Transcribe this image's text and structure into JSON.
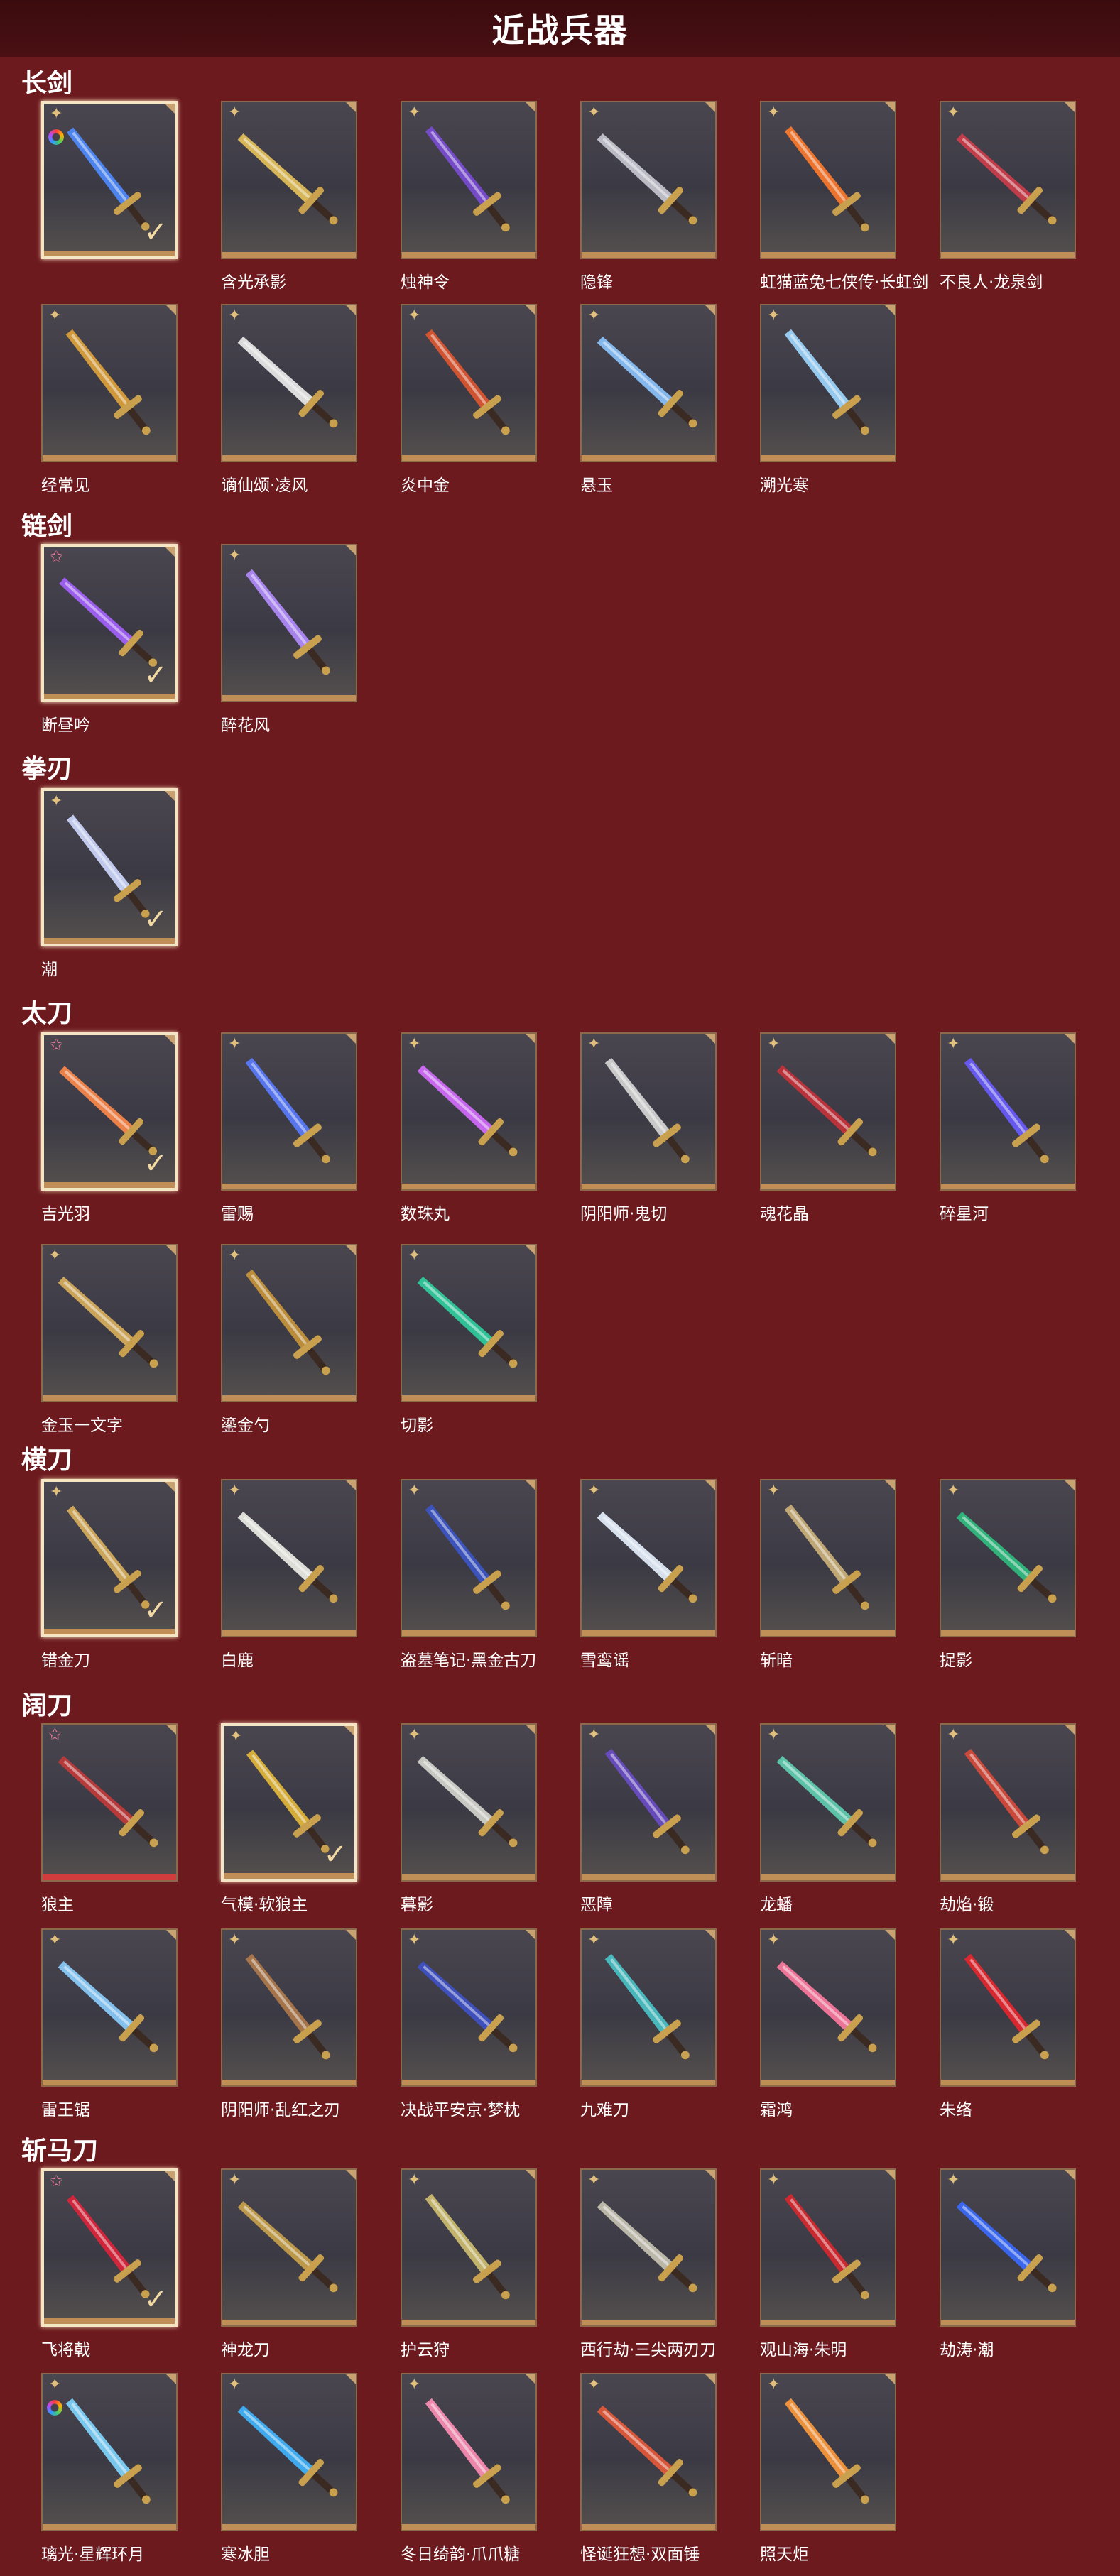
{
  "header": {
    "title": "近战兵器"
  },
  "sections": [
    {
      "title": "长剑",
      "items": [
        {
          "label": "",
          "rarity": "gold",
          "badge": "rainbow",
          "selected": true,
          "color": "#4f8cff"
        },
        {
          "label": "含光承影",
          "rarity": "gold",
          "color": "#e7c35a"
        },
        {
          "label": "烛神令",
          "rarity": "gold",
          "color": "#7b4cd6"
        },
        {
          "label": "隐锋",
          "rarity": "gold",
          "color": "#c9c9d3"
        },
        {
          "label": "虹猫蓝兔七侠传·长虹剑",
          "rarity": "gold",
          "color": "#ff7a2b"
        },
        {
          "label": "不良人·龙泉剑",
          "rarity": "gold",
          "color": "#cf3d4a"
        },
        {
          "label": "经常见",
          "rarity": "gold",
          "color": "#e0a33a"
        },
        {
          "label": "谪仙颂·凌风",
          "rarity": "gold",
          "color": "#ededed"
        },
        {
          "label": "炎中金",
          "rarity": "gold",
          "color": "#e0572f"
        },
        {
          "label": "悬玉",
          "rarity": "gold",
          "color": "#8cc5ff"
        },
        {
          "label": "溯光寒",
          "rarity": "gold",
          "color": "#9fd8ff"
        }
      ]
    },
    {
      "title": "链剑",
      "items": [
        {
          "label": "断昼吟",
          "rarity": "pink",
          "selected": true,
          "color": "#a562ff"
        },
        {
          "label": "醉花风",
          "rarity": "gold",
          "color": "#b48cff"
        }
      ]
    },
    {
      "title": "拳刃",
      "items": [
        {
          "label": "潮",
          "rarity": "gold",
          "selected": true,
          "color": "#cfd9ff"
        }
      ]
    },
    {
      "title": "太刀",
      "items": [
        {
          "label": "吉光羽",
          "rarity": "pink",
          "selected": true,
          "color": "#ff8a4a"
        },
        {
          "label": "雷赐",
          "rarity": "gold",
          "color": "#5a7cff"
        },
        {
          "label": "数珠丸",
          "rarity": "gold",
          "color": "#d56cff"
        },
        {
          "label": "阴阳师·鬼切",
          "rarity": "gold",
          "color": "#d8d8d8"
        },
        {
          "label": "魂花晶",
          "rarity": "gold",
          "color": "#c8323a"
        },
        {
          "label": "碎星河",
          "rarity": "gold",
          "color": "#6a5cff"
        },
        {
          "label": "金玉一文字",
          "rarity": "gold",
          "color": "#d9b05c"
        },
        {
          "label": "鎏金勺",
          "rarity": "gold",
          "color": "#c9963a"
        },
        {
          "label": "切影",
          "rarity": "gold",
          "color": "#2fcfa0"
        }
      ]
    },
    {
      "title": "横刀",
      "items": [
        {
          "label": "错金刀",
          "rarity": "gold",
          "selected": true,
          "color": "#d9b05c"
        },
        {
          "label": "白鹿",
          "rarity": "gold",
          "color": "#f0efe8"
        },
        {
          "label": "盗墓笔记·黑金古刀",
          "rarity": "gold",
          "color": "#3b55c8"
        },
        {
          "label": "雪鸾谣",
          "rarity": "gold",
          "color": "#e8f2ff"
        },
        {
          "label": "斩暗",
          "rarity": "gold",
          "color": "#cdb37a"
        },
        {
          "label": "捉影",
          "rarity": "gold",
          "color": "#2fbf7f"
        }
      ]
    },
    {
      "title": "阔刀",
      "items": [
        {
          "label": "狼主",
          "rarity": "pink",
          "color": "#c43a3a"
        },
        {
          "label": "气模·软狼主",
          "rarity": "gold",
          "selected": true,
          "color": "#e5b93a"
        },
        {
          "label": "暮影",
          "rarity": "gold",
          "color": "#d7d7cf"
        },
        {
          "label": "恶障",
          "rarity": "gold",
          "color": "#6a4cc8"
        },
        {
          "label": "龙蟠",
          "rarity": "gold",
          "color": "#5fd0b2"
        },
        {
          "label": "劫焰·锻",
          "rarity": "gold",
          "color": "#d84a3a"
        },
        {
          "label": "雷王锯",
          "rarity": "gold",
          "color": "#8ccfff"
        },
        {
          "label": "阴阳师·乱红之刃",
          "rarity": "gold",
          "color": "#b07a4a"
        },
        {
          "label": "决战平安京·梦枕",
          "rarity": "gold",
          "color": "#3f52c9"
        },
        {
          "label": "九难刀",
          "rarity": "gold",
          "color": "#49c4c8"
        },
        {
          "label": "霜鸿",
          "rarity": "gold",
          "color": "#ff7aa0"
        },
        {
          "label": "朱络",
          "rarity": "gold",
          "color": "#e8262e"
        }
      ]
    },
    {
      "title": "斩马刀",
      "items": [
        {
          "label": "飞将戟",
          "rarity": "pink",
          "selected": true,
          "color": "#e0243a"
        },
        {
          "label": "神龙刀",
          "rarity": "gold",
          "color": "#c9a24a"
        },
        {
          "label": "护云狩",
          "rarity": "gold",
          "color": "#d0c070"
        },
        {
          "label": "西行劫·三尖两刃刀",
          "rarity": "gold",
          "color": "#c8c4b4"
        },
        {
          "label": "观山海·朱明",
          "rarity": "gold",
          "color": "#d8282e"
        },
        {
          "label": "劫涛·潮",
          "rarity": "gold",
          "color": "#3a6cff"
        },
        {
          "label": "璃光·星辉环月",
          "rarity": "gold",
          "badge": "rainbow",
          "color": "#7fd6ff"
        },
        {
          "label": "寒冰胆",
          "rarity": "gold",
          "color": "#3fb6ff"
        },
        {
          "label": "冬日绮韵·爪爪糖",
          "rarity": "gold",
          "color": "#ff8fb6"
        },
        {
          "label": "怪诞狂想·双面锤",
          "rarity": "gold",
          "color": "#e85a3a"
        },
        {
          "label": "照天炬",
          "rarity": "gold",
          "color": "#ff9a3a"
        }
      ]
    }
  ]
}
